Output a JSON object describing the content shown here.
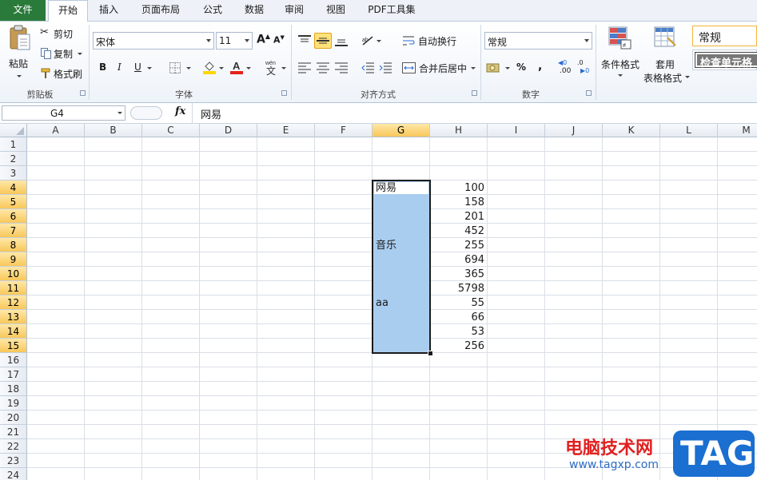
{
  "tabs": [
    "文件",
    "开始",
    "插入",
    "页面布局",
    "公式",
    "数据",
    "审阅",
    "视图",
    "PDF工具集"
  ],
  "clipboard": {
    "paste": "粘贴",
    "cut": "剪切",
    "copy": "复制",
    "format_painter": "格式刷",
    "group": "剪贴板"
  },
  "font": {
    "name": "宋体",
    "size": "11",
    "bold": "B",
    "italic": "I",
    "underline": "U",
    "group": "字体",
    "font_color": "#e3231b",
    "fill_color": "#ffd700"
  },
  "alignment": {
    "wrap": "自动换行",
    "merge": "合并后居中",
    "group": "对齐方式"
  },
  "number": {
    "format": "常规",
    "percent": "%",
    "comma": ",",
    "inc_decimal": ".00",
    "dec_decimal": ".0",
    "group": "数字"
  },
  "styles": {
    "conditional": "条件格式",
    "table_format_1": "套用",
    "table_format_2": "表格格式",
    "normal_style": "常规",
    "check_cell": "检查单元格"
  },
  "formula_bar": {
    "name_box": "G4",
    "fx": "fx",
    "content": "网易"
  },
  "columns": [
    "A",
    "B",
    "C",
    "D",
    "E",
    "F",
    "G",
    "H",
    "I",
    "J",
    "K",
    "L",
    "M"
  ],
  "selected_column": "G",
  "rows": [
    "1",
    "2",
    "3",
    "4",
    "5",
    "6",
    "7",
    "8",
    "9",
    "10",
    "11",
    "12",
    "13",
    "14",
    "15",
    "16",
    "17",
    "18",
    "19",
    "20",
    "21",
    "22",
    "23",
    "24"
  ],
  "selected_rows": [
    "4",
    "5",
    "6",
    "7",
    "8",
    "9",
    "10",
    "11",
    "12",
    "13",
    "14",
    "15"
  ],
  "cells": {
    "G4": "网易",
    "G8": "音乐",
    "G12": "aa",
    "H4": "100",
    "H5": "158",
    "H6": "201",
    "H7": "452",
    "H8": "255",
    "H9": "694",
    "H10": "365",
    "H11": "5798",
    "H12": "55",
    "H13": "66",
    "H14": "53",
    "H15": "256"
  },
  "watermark": {
    "title": "电脑技术网",
    "url": "www.tagxp.com",
    "badge": "TAG"
  }
}
